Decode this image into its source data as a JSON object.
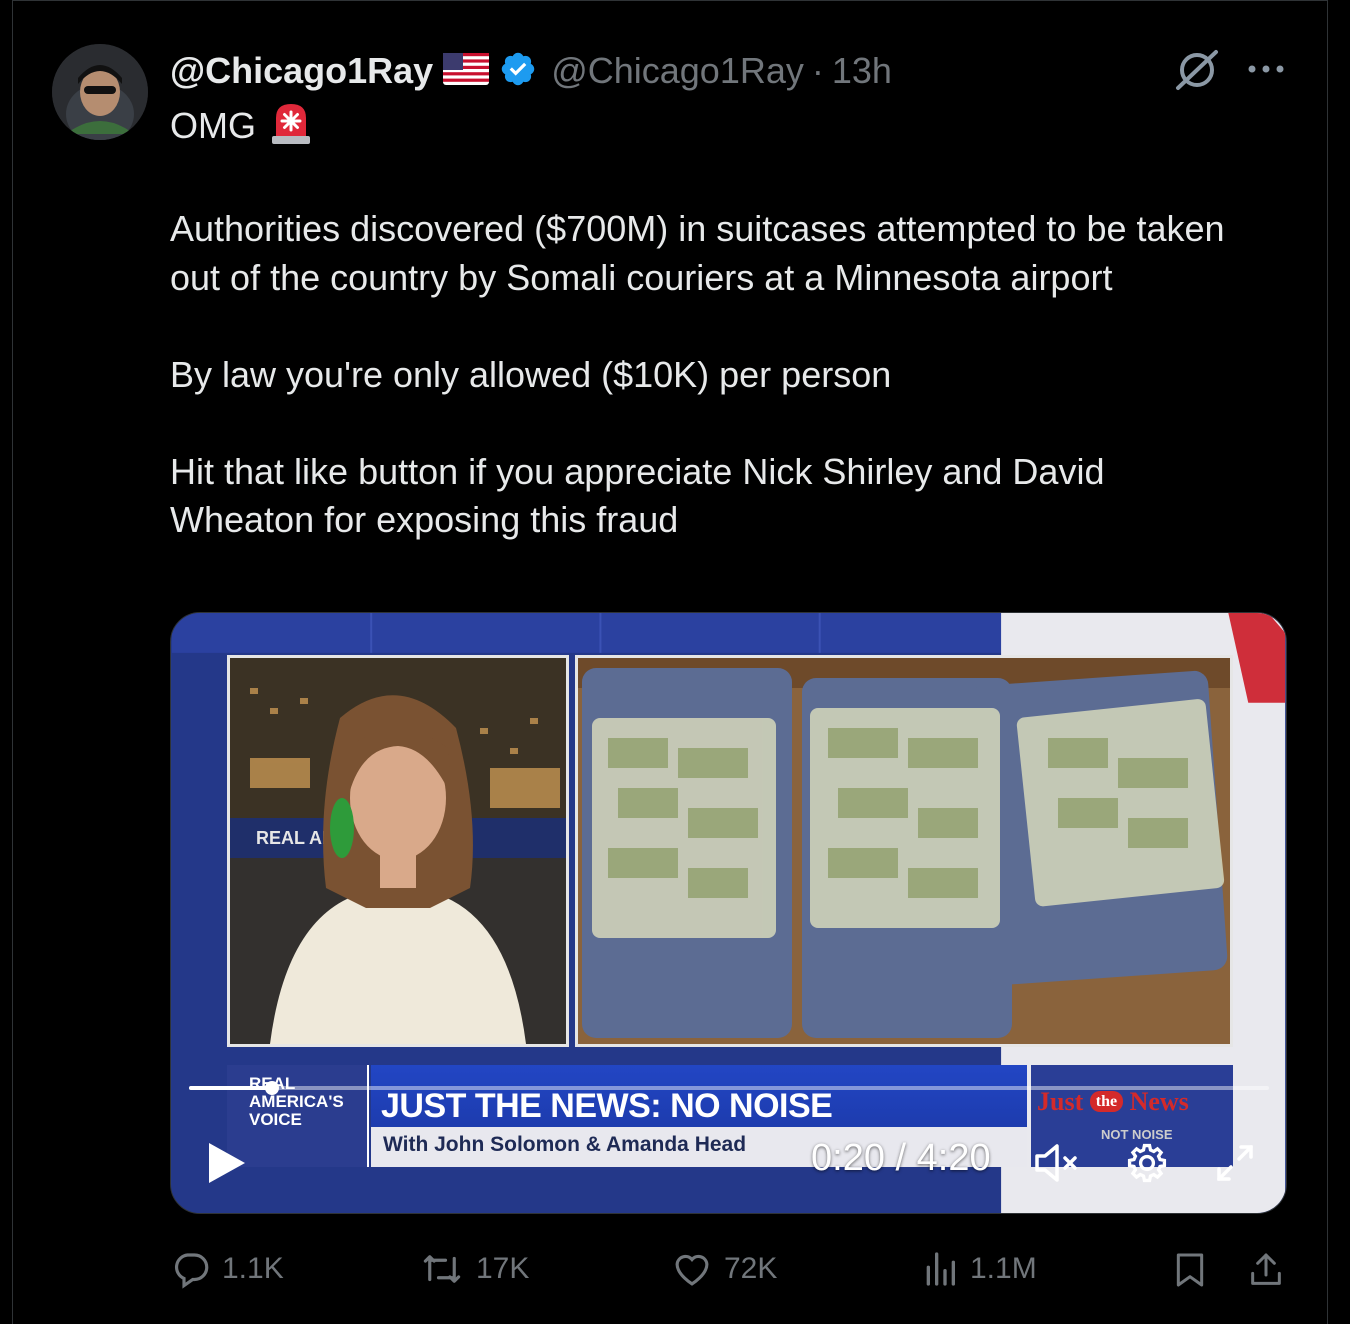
{
  "tweet": {
    "display_name": "@Chicago1Ray",
    "handle": "@Chicago1Ray",
    "separator": "·",
    "time": "13h",
    "paragraphs": [
      "OMG",
      "Authorities discovered ($700M) in suitcases attempted to be taken out of the country by Somali couriers at a Minnesota airport",
      "By law you're only allowed ($10K) per person",
      "Hit that like button if you appreciate Nick Shirley and David Wheaton for exposing this fraud"
    ]
  },
  "video": {
    "lower_third": {
      "logo_lines": [
        "REAL",
        "AMERICA'S",
        "VOICE"
      ],
      "title": "JUST THE NEWS: NO NOISE",
      "subtitle": "With John Solomon & Amanda Head",
      "brand_just": "Just",
      "brand_the": "the",
      "brand_news": "News",
      "brand_tagline": "NOT NOISE"
    },
    "in_video_sign": "REAL AM",
    "time_display": "0:20 / 4:20",
    "progress_fraction": 0.077
  },
  "actions": {
    "replies": "1.1K",
    "reposts": "17K",
    "likes": "72K",
    "views": "1.1M"
  },
  "icons": [
    "avatar",
    "us-flag-icon",
    "verified-badge-icon",
    "grok-icon",
    "more-icon",
    "siren-icon",
    "play-icon",
    "muted-volume-icon",
    "gear-icon",
    "fullscreen-icon",
    "reply-icon",
    "repost-icon",
    "heart-icon",
    "views-icon",
    "bookmark-icon",
    "share-icon"
  ],
  "colors": {
    "background": "#000000",
    "text": "#e7e9ea",
    "secondary": "#71767b",
    "verified": "#1d9bf0",
    "video_blue": "#253a8a"
  }
}
